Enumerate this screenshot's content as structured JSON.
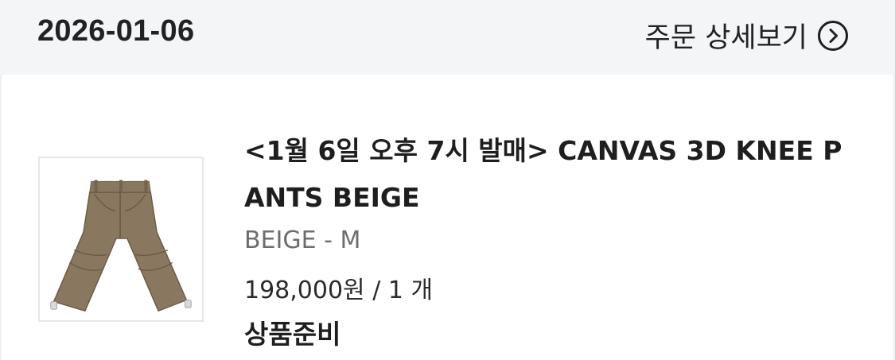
{
  "order": {
    "date": "2026-01-06",
    "detail_link_label": "주문 상세보기",
    "detail_icon": "chevron-right-circle-icon"
  },
  "product": {
    "name": "<1월 6일 오후 7시 발매> CANVAS 3D KNEE PANTS BEIGE",
    "option": "BEIGE - M",
    "price_quantity": "198,000원 / 1 개",
    "status": "상품준비",
    "thumbnail_icon": "pants-image",
    "thumbnail_color": "#8a7760"
  },
  "colors": {
    "header_bg": "#f4f5f7",
    "text_primary": "#1e1e1e",
    "text_secondary": "#6d6d6d"
  }
}
